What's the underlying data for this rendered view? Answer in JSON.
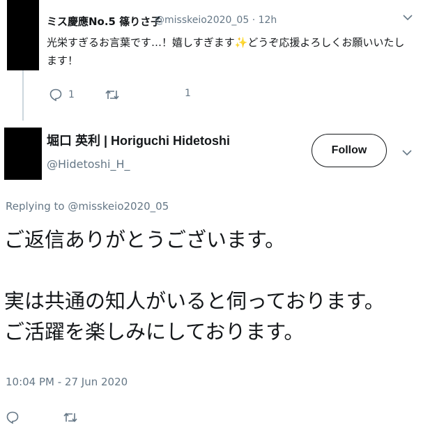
{
  "reply_tweet": {
    "author_name": "ミス慶應No.5 篠りさ子",
    "handle": "@misskeio2020_05",
    "separator": "·",
    "time": "12h",
    "text": "光栄すぎるお言葉です…！嬉しすぎます✨どうぞ応援よろしくお願いいたします！",
    "reply_count": "1",
    "like_count": "1"
  },
  "main_tweet": {
    "author_name": "堀口 英利 | Horiguchi Hidetoshi",
    "handle": "@Hidetoshi_H_",
    "follow_label": "Follow",
    "replying_prefix": "Replying to",
    "replying_handle": "@misskeio2020_05",
    "text_lines": [
      "ご返信ありがとうございます。",
      "実は共通の知人がいると伺っております。",
      "ご活躍を楽しみにしております。"
    ],
    "timestamp": "10:04 PM - 27 Jun 2020"
  },
  "icons": {
    "reply": "speech-bubble-icon",
    "retweet": "retweet-arrows-icon",
    "like": "heart-icon",
    "caret": "chevron-down-icon"
  },
  "colors": {
    "text": "#14171a",
    "secondary": "#657786",
    "thread_line": "#ccd6dd"
  }
}
